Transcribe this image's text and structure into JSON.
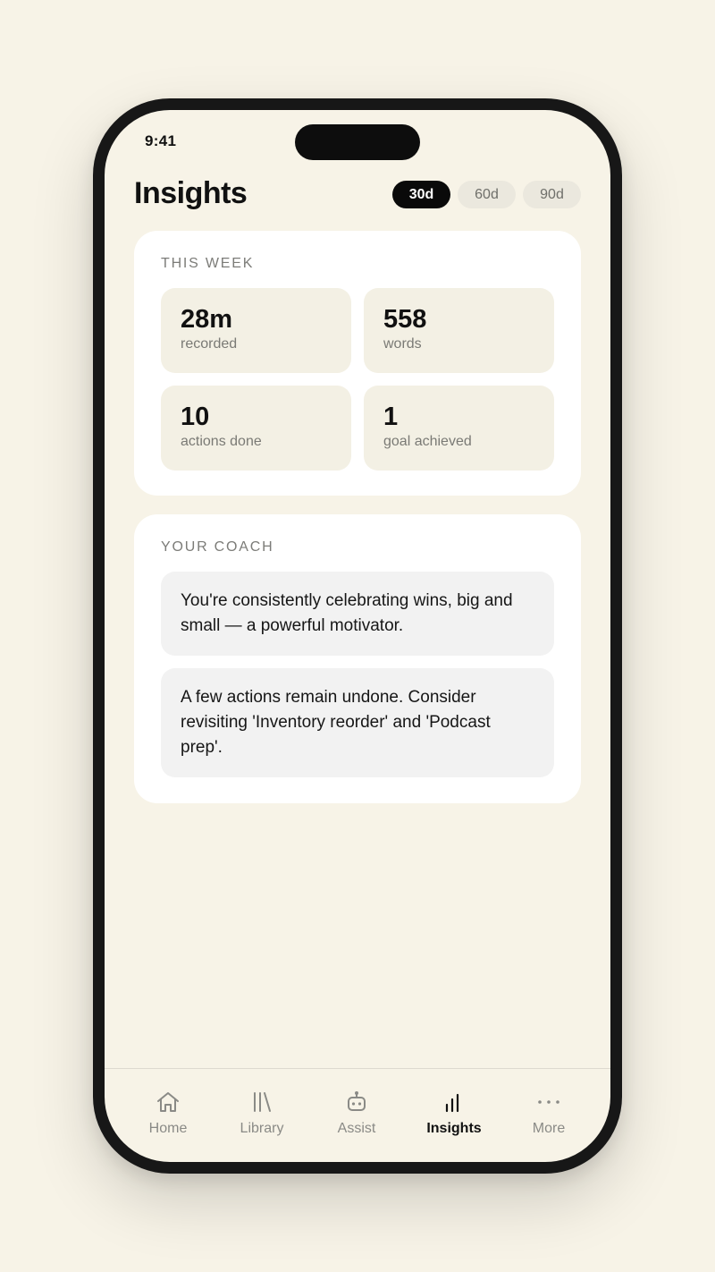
{
  "status_bar": {
    "time": "9:41"
  },
  "header": {
    "title": "Insights",
    "ranges": [
      {
        "label": "30d",
        "active": true
      },
      {
        "label": "60d",
        "active": false
      },
      {
        "label": "90d",
        "active": false
      }
    ]
  },
  "this_week": {
    "label": "THIS WEEK",
    "stats": [
      {
        "value": "28m",
        "caption": "recorded"
      },
      {
        "value": "558",
        "caption": "words"
      },
      {
        "value": "10",
        "caption": "actions done"
      },
      {
        "value": "1",
        "caption": "goal achieved"
      }
    ]
  },
  "coach": {
    "label": "YOUR COACH",
    "insights": [
      "You're consistently celebrating wins, big and small — a powerful motivator.",
      "A few actions remain undone. Consider revisiting 'Inventory reorder' and 'Podcast prep'."
    ]
  },
  "tabbar": {
    "items": [
      {
        "label": "Home",
        "icon": "home-icon",
        "active": false
      },
      {
        "label": "Library",
        "icon": "library-icon",
        "active": false
      },
      {
        "label": "Assist",
        "icon": "robot-icon",
        "active": false
      },
      {
        "label": "Insights",
        "icon": "bar-chart-icon",
        "active": true
      },
      {
        "label": "More",
        "icon": "more-dots-icon",
        "active": false
      }
    ]
  },
  "colors": {
    "background": "#f7f3e7",
    "card": "#ffffff",
    "tile": "#f3f0e4",
    "active_pill": "#0a0a0a",
    "inactive_pill": "#ebe8de"
  }
}
